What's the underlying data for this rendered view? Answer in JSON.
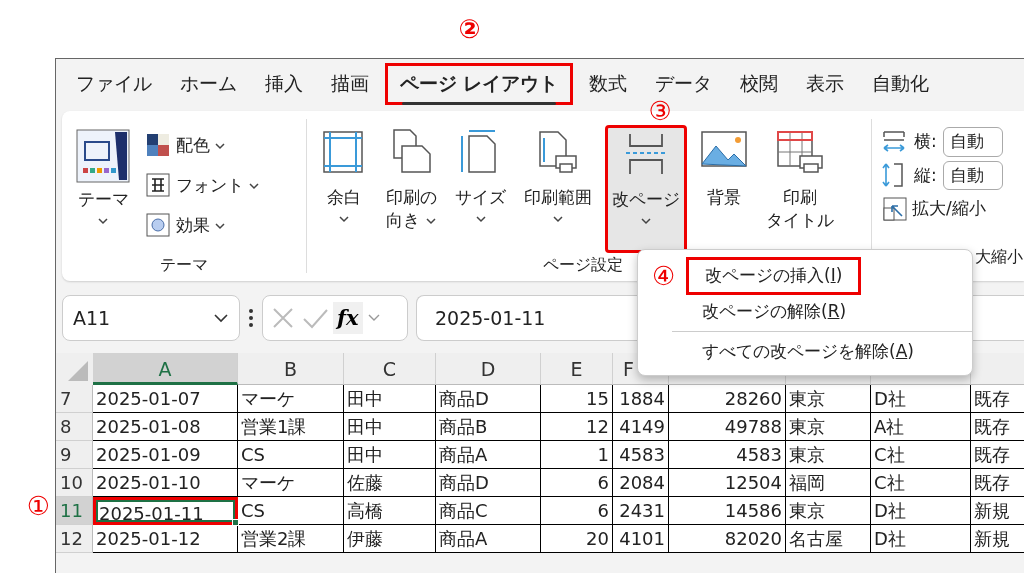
{
  "tabs": [
    {
      "label": "ファイル",
      "selected": false
    },
    {
      "label": "ホーム",
      "selected": false
    },
    {
      "label": "挿入",
      "selected": false
    },
    {
      "label": "描画",
      "selected": false
    },
    {
      "label": "ページ レイアウト",
      "selected": true,
      "annotated": true,
      "annotation": "②"
    },
    {
      "label": "数式",
      "selected": false
    },
    {
      "label": "データ",
      "selected": false
    },
    {
      "label": "校閲",
      "selected": false
    },
    {
      "label": "表示",
      "selected": false
    },
    {
      "label": "自動化",
      "selected": false
    }
  ],
  "ribbon": {
    "groups": [
      {
        "label": "テーマ",
        "big": [
          {
            "lines": [
              "テーマ"
            ],
            "dropdown": true,
            "pressed": false
          }
        ],
        "small": [
          {
            "label": "配色",
            "dropdown": true
          },
          {
            "label": "フォント",
            "dropdown": true
          },
          {
            "label": "効果",
            "dropdown": true
          }
        ]
      },
      {
        "label": "ページ設定",
        "big": [
          {
            "lines": [
              "余白"
            ],
            "dropdown": true,
            "pressed": false
          },
          {
            "lines": [
              "印刷の",
              "向き"
            ],
            "dropdown": true,
            "pressed": false
          },
          {
            "lines": [
              "サイズ"
            ],
            "dropdown": true,
            "pressed": false
          },
          {
            "lines": [
              "印刷範囲"
            ],
            "dropdown": true,
            "pressed": false
          },
          {
            "lines": [
              "改ページ"
            ],
            "dropdown": true,
            "pressed": true,
            "annotated": true,
            "annotation": "③"
          },
          {
            "lines": [
              "背景"
            ],
            "dropdown": false,
            "pressed": false
          },
          {
            "lines": [
              "印刷",
              "タイトル"
            ],
            "dropdown": false,
            "pressed": false
          }
        ]
      },
      {
        "label": "大縮小",
        "fields": [
          {
            "label": "横:",
            "value": "自動"
          },
          {
            "label": "縦:",
            "value": "自動"
          }
        ],
        "small": [
          {
            "label": "拡大/縮小"
          }
        ]
      }
    ]
  },
  "name_box": {
    "value": "A11"
  },
  "formula_bar": {
    "fx": "fx",
    "value": "2025-01-11"
  },
  "menu": {
    "items": [
      {
        "label_before": "改ページの挿入(",
        "access_key": "I",
        "label_after": ")",
        "separator_before": false,
        "annotated": true,
        "annotation": "④"
      },
      {
        "label_before": "改ページの解除(",
        "access_key": "R",
        "label_after": ")",
        "separator_before": false,
        "annotated": false
      },
      {
        "label_before": "すべての改ページを解除(",
        "access_key": "A",
        "label_after": ")",
        "separator_before": true,
        "annotated": false
      }
    ]
  },
  "sheet": {
    "columns": [
      {
        "label": "A",
        "selected": true,
        "numeric": false
      },
      {
        "label": "B",
        "selected": false,
        "numeric": false
      },
      {
        "label": "C",
        "selected": false,
        "numeric": false
      },
      {
        "label": "D",
        "selected": false,
        "numeric": false
      },
      {
        "label": "E",
        "selected": false,
        "numeric": true
      },
      {
        "label": "F",
        "selected": false,
        "numeric": true
      },
      {
        "numeric": true
      },
      {
        "numeric": false
      },
      {
        "numeric": false
      },
      {
        "numeric": false
      }
    ],
    "rows": [
      {
        "header": "7",
        "selected": false,
        "cells": [
          {
            "v": "2025-01-07",
            "selected": false
          },
          {
            "v": "マーケ",
            "selected": false
          },
          {
            "v": "田中",
            "selected": false
          },
          {
            "v": "商品D",
            "selected": false
          },
          {
            "v": "15",
            "selected": false
          },
          {
            "v": "1884",
            "selected": false
          },
          {
            "v": "28260",
            "selected": false
          },
          {
            "v": "東京",
            "selected": false
          },
          {
            "v": "D社",
            "selected": false
          },
          {
            "v": "既存",
            "selected": false
          }
        ]
      },
      {
        "header": "8",
        "selected": false,
        "cells": [
          {
            "v": "2025-01-08",
            "selected": false
          },
          {
            "v": "営業1課",
            "selected": false
          },
          {
            "v": "田中",
            "selected": false
          },
          {
            "v": "商品B",
            "selected": false
          },
          {
            "v": "12",
            "selected": false
          },
          {
            "v": "4149",
            "selected": false
          },
          {
            "v": "49788",
            "selected": false
          },
          {
            "v": "東京",
            "selected": false
          },
          {
            "v": "A社",
            "selected": false
          },
          {
            "v": "既存",
            "selected": false
          }
        ]
      },
      {
        "header": "9",
        "selected": false,
        "cells": [
          {
            "v": "2025-01-09",
            "selected": false
          },
          {
            "v": "CS",
            "selected": false
          },
          {
            "v": "田中",
            "selected": false
          },
          {
            "v": "商品A",
            "selected": false
          },
          {
            "v": "1",
            "selected": false
          },
          {
            "v": "4583",
            "selected": false
          },
          {
            "v": "4583",
            "selected": false
          },
          {
            "v": "東京",
            "selected": false
          },
          {
            "v": "C社",
            "selected": false
          },
          {
            "v": "既存",
            "selected": false
          }
        ]
      },
      {
        "header": "10",
        "selected": false,
        "cells": [
          {
            "v": "2025-01-10",
            "selected": false
          },
          {
            "v": "マーケ",
            "selected": false
          },
          {
            "v": "佐藤",
            "selected": false
          },
          {
            "v": "商品D",
            "selected": false
          },
          {
            "v": "6",
            "selected": false
          },
          {
            "v": "2084",
            "selected": false
          },
          {
            "v": "12504",
            "selected": false
          },
          {
            "v": "福岡",
            "selected": false
          },
          {
            "v": "C社",
            "selected": false
          },
          {
            "v": "既存",
            "selected": false
          }
        ]
      },
      {
        "header": "11",
        "selected": true,
        "cells": [
          {
            "v": "2025-01-11",
            "selected": true,
            "annotated": true,
            "annotation": "①"
          },
          {
            "v": "CS",
            "selected": false
          },
          {
            "v": "高橋",
            "selected": false
          },
          {
            "v": "商品C",
            "selected": false
          },
          {
            "v": "6",
            "selected": false
          },
          {
            "v": "2431",
            "selected": false
          },
          {
            "v": "14586",
            "selected": false
          },
          {
            "v": "東京",
            "selected": false
          },
          {
            "v": "D社",
            "selected": false
          },
          {
            "v": "新規",
            "selected": false
          }
        ]
      },
      {
        "header": "12",
        "selected": false,
        "cells": [
          {
            "v": "2025-01-12",
            "selected": false
          },
          {
            "v": "営業2課",
            "selected": false
          },
          {
            "v": "伊藤",
            "selected": false
          },
          {
            "v": "商品A",
            "selected": false
          },
          {
            "v": "20",
            "selected": false
          },
          {
            "v": "4101",
            "selected": false
          },
          {
            "v": "82020",
            "selected": false
          },
          {
            "v": "名古屋",
            "selected": false
          },
          {
            "v": "D社",
            "selected": false
          },
          {
            "v": "新規",
            "selected": false
          }
        ]
      }
    ]
  }
}
